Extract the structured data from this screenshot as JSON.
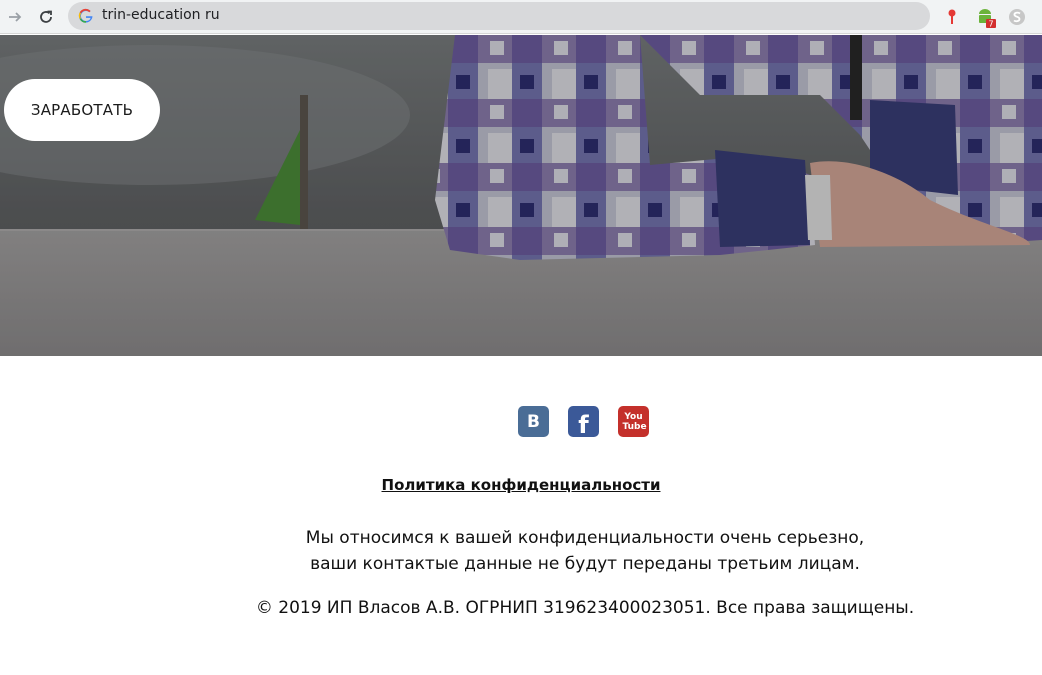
{
  "browser": {
    "url": "trin-education ru"
  },
  "hero": {
    "cta_label": "ЗАРАБОТАТЬ"
  },
  "footer": {
    "social": [
      {
        "name": "vk",
        "label": "B",
        "color": "#4a6d96"
      },
      {
        "name": "facebook",
        "label": "f",
        "color": "#3b5998"
      },
      {
        "name": "youtube",
        "label": "You Tube",
        "color": "#c4302b"
      }
    ],
    "policy_link": "Политика конфиденциальности",
    "privacy_line1": "Мы относимся к вашей конфиденциальности очень серьезно,",
    "privacy_line2": "ваши контактые данные не будут переданы третьим лицам.",
    "copyright": "© 2019 ИП Власов А.В. ОГРНИП 319623400023051. Все права защищены."
  }
}
